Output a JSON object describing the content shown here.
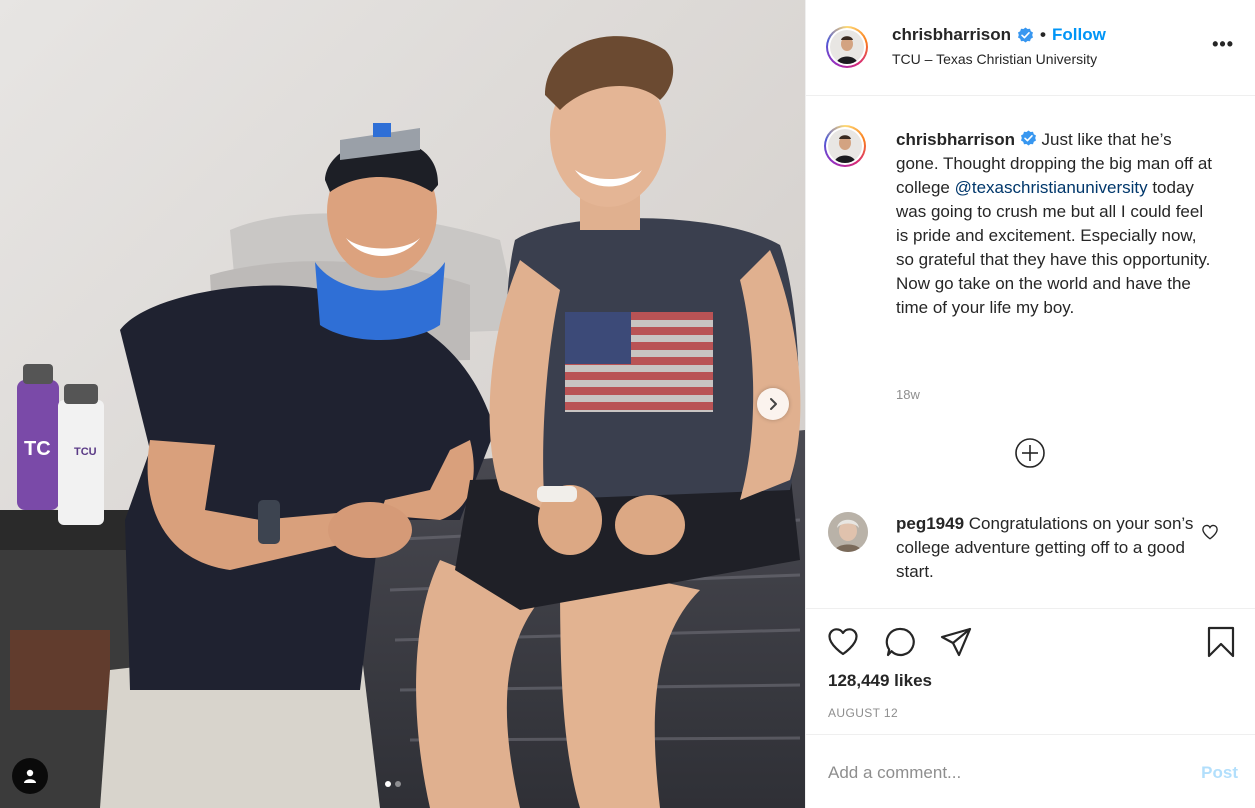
{
  "media": {
    "carousel_dots": 2,
    "active_dot": 0,
    "icons": {
      "next": "chevron-right-icon",
      "tag": "user-tag-icon"
    }
  },
  "header": {
    "username": "chrisbharrison",
    "verified": true,
    "separator": "•",
    "follow_label": "Follow",
    "location": "TCU – Texas Christian University",
    "more_label": "•••"
  },
  "caption": {
    "username": "chrisbharrison",
    "text_before": "Just like that he’s gone. Thought dropping the big man off at college ",
    "mention": "@texaschristianuniversity",
    "text_after": " today was going to crush me but all I could feel is pride and excitement. Especially now, so grateful that they have this opportunity. Now go take on the world and have the time of your life my boy.",
    "age": "18w"
  },
  "comments": [
    {
      "username": "peg1949",
      "text": "Congratulations on your son’s college adventure getting off to a good start."
    }
  ],
  "actions": {
    "icons": [
      "heart-icon",
      "comment-icon",
      "share-icon",
      "bookmark-icon"
    ],
    "likes": "128,449 likes",
    "date": "AUGUST 12"
  },
  "add_comment": {
    "placeholder": "Add a comment...",
    "post_label": "Post"
  },
  "colors": {
    "accent": "#0095f6",
    "mention": "#00376b",
    "muted": "#8e8e8e",
    "post_disabled": "#b2dffc",
    "verified": "#3897f0"
  }
}
